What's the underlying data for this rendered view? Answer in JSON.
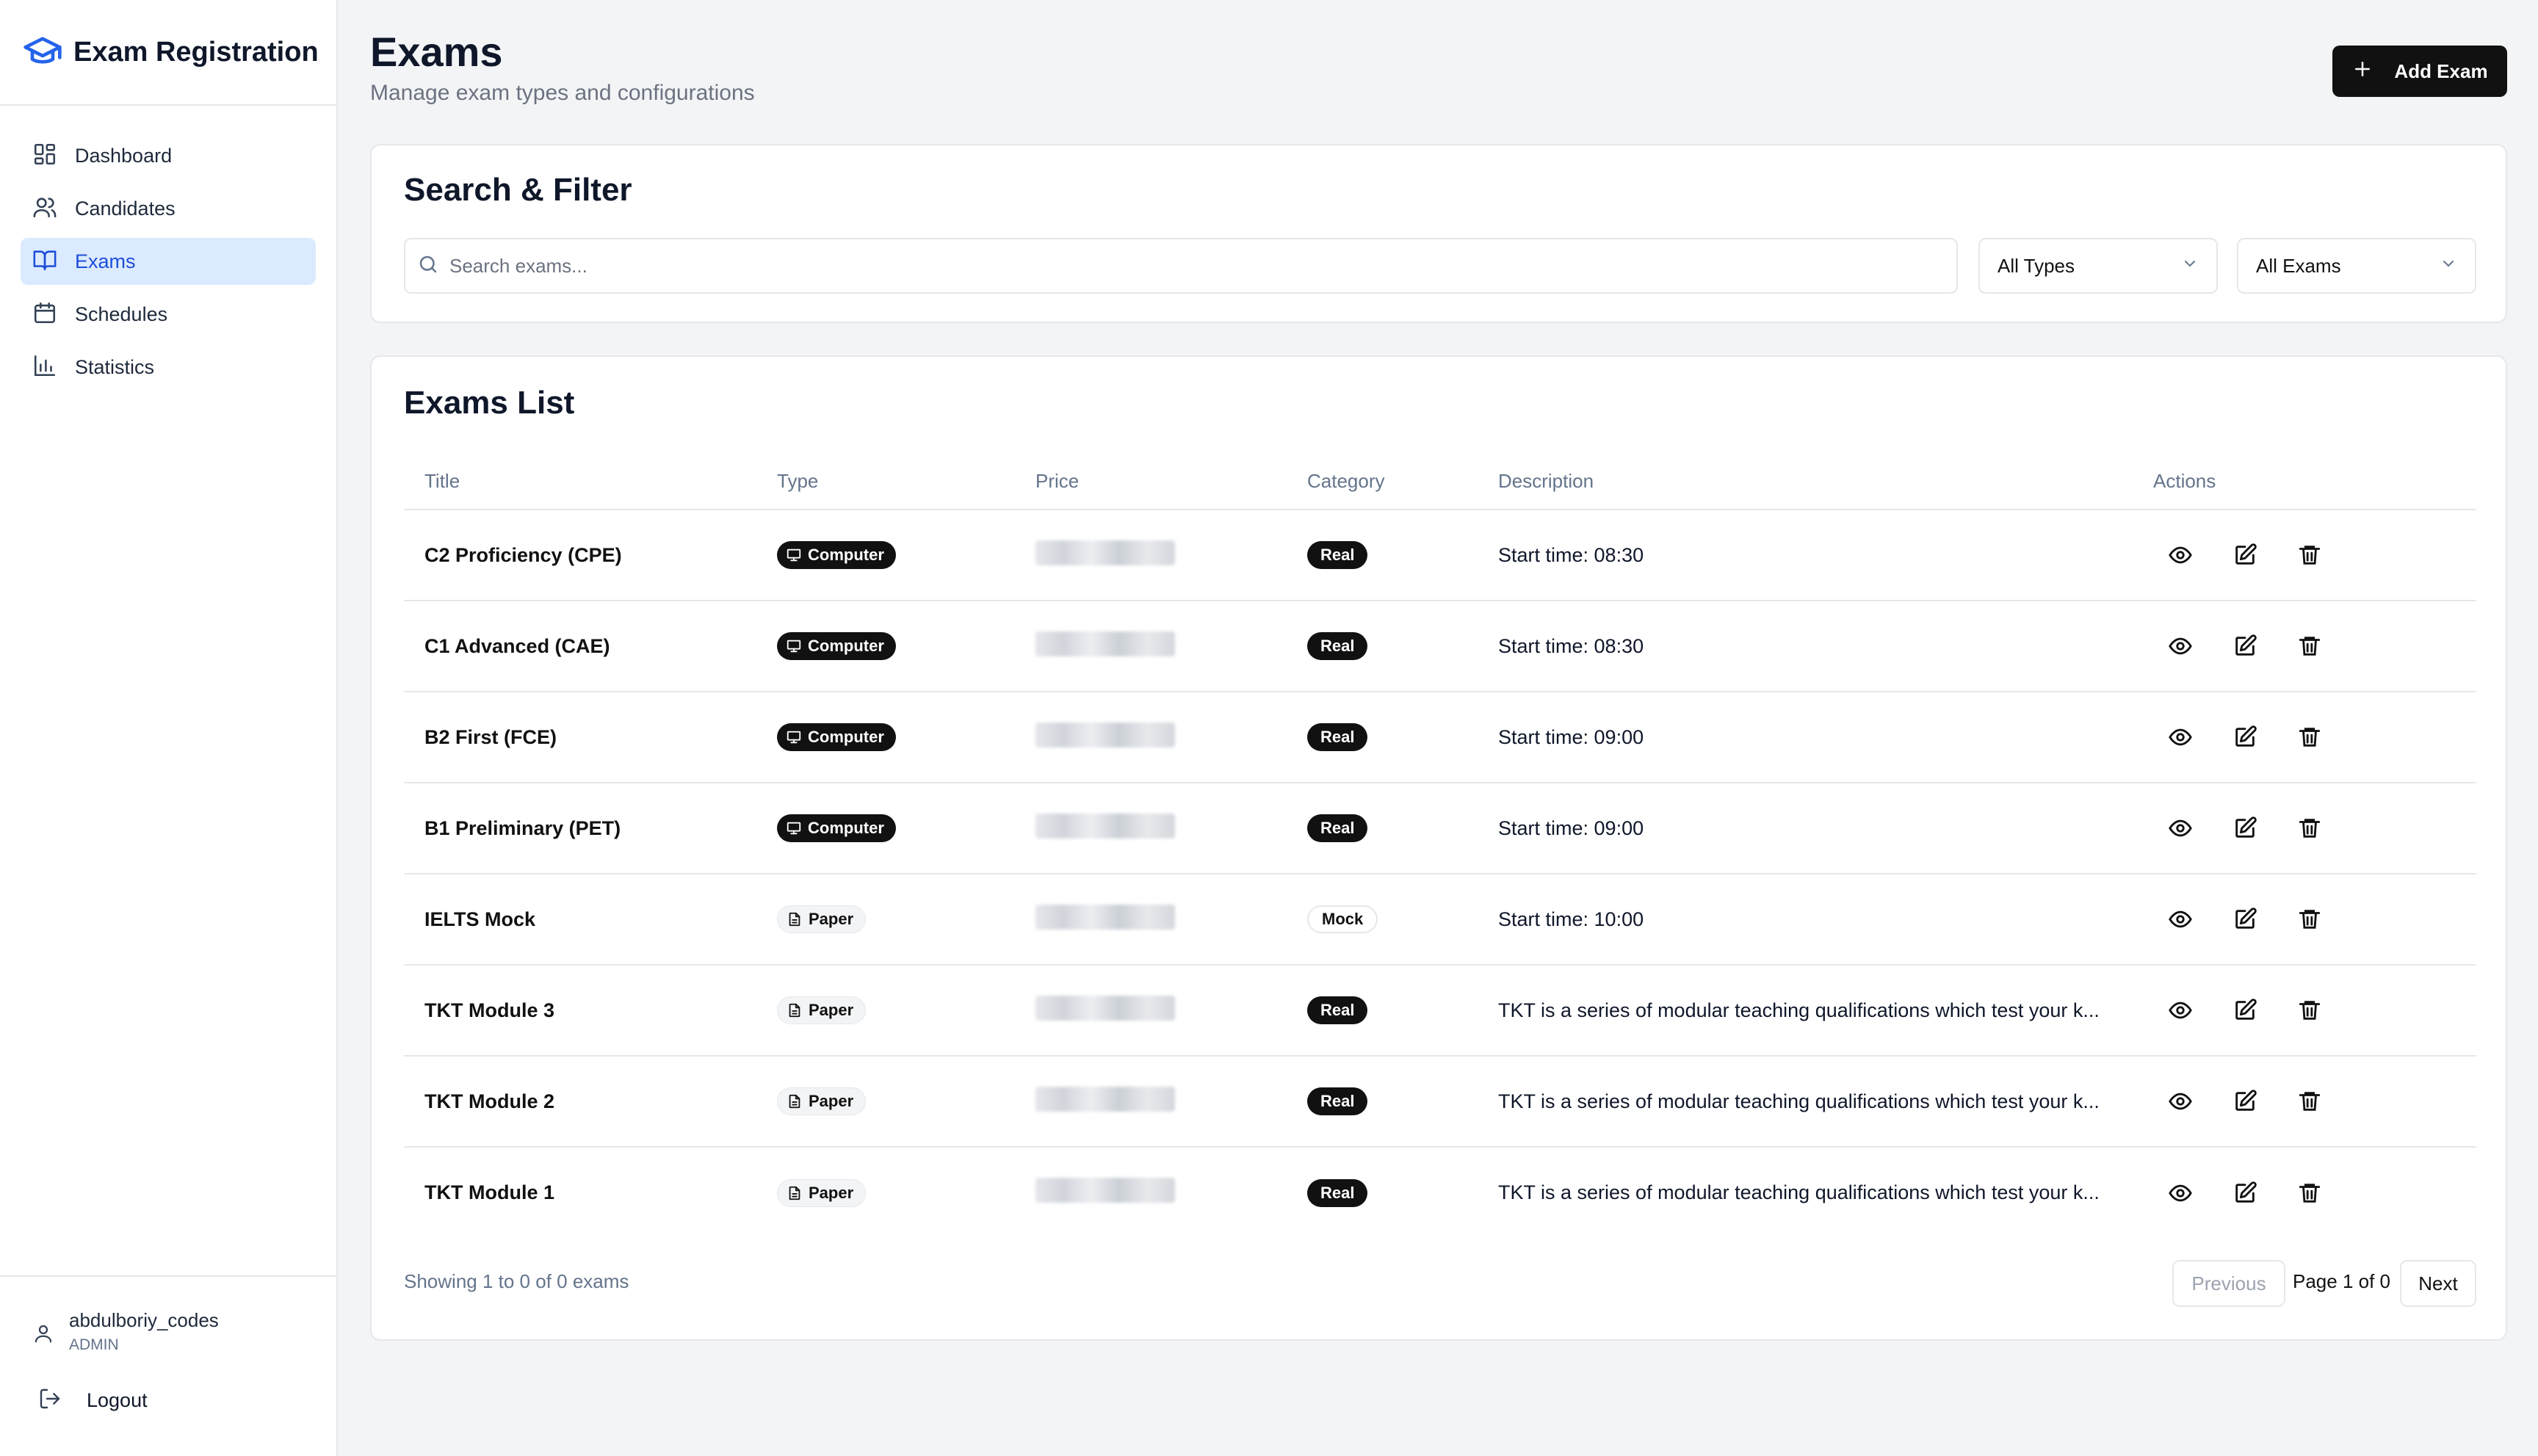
{
  "sidebar": {
    "brand": "Exam Registration",
    "nav": [
      {
        "label": "Dashboard",
        "icon": "dashboard-icon"
      },
      {
        "label": "Candidates",
        "icon": "users-icon"
      },
      {
        "label": "Exams",
        "icon": "book-icon",
        "active": true
      },
      {
        "label": "Schedules",
        "icon": "calendar-icon"
      },
      {
        "label": "Statistics",
        "icon": "bar-chart-icon"
      }
    ],
    "user": {
      "name": "abdulboriy_codes",
      "role": "ADMIN"
    },
    "logout_label": "Logout"
  },
  "header": {
    "title": "Exams",
    "subtitle": "Manage exam types and configurations",
    "add_button_label": "Add Exam"
  },
  "filter": {
    "title": "Search & Filter",
    "search_placeholder": "Search exams...",
    "type_select": "All Types",
    "exam_select": "All Exams"
  },
  "exams_list": {
    "title": "Exams List",
    "columns": [
      "Title",
      "Type",
      "Price",
      "Category",
      "Description",
      "Actions"
    ],
    "rows": [
      {
        "title": "C2 Proficiency (CPE)",
        "type": "Computer",
        "category": "Real",
        "description": "Start time: 08:30"
      },
      {
        "title": "C1 Advanced (CAE)",
        "type": "Computer",
        "category": "Real",
        "description": "Start time: 08:30"
      },
      {
        "title": "B2 First (FCE)",
        "type": "Computer",
        "category": "Real",
        "description": "Start time: 09:00"
      },
      {
        "title": "B1 Preliminary (PET)",
        "type": "Computer",
        "category": "Real",
        "description": "Start time: 09:00"
      },
      {
        "title": "IELTS Mock",
        "type": "Paper",
        "category": "Mock",
        "description": "Start time: 10:00"
      },
      {
        "title": "TKT Module 3",
        "type": "Paper",
        "category": "Real",
        "description": "TKT is a series of modular teaching qualifications which test your k..."
      },
      {
        "title": "TKT Module 2",
        "type": "Paper",
        "category": "Real",
        "description": "TKT is a series of modular teaching qualifications which test your k..."
      },
      {
        "title": "TKT Module 1",
        "type": "Paper",
        "category": "Real",
        "description": "TKT is a series of modular teaching qualifications which test your k..."
      }
    ],
    "showing_text": "Showing 1 to 0 of 0 exams",
    "prev_label": "Previous",
    "page_text": "Page 1 of 0",
    "next_label": "Next"
  },
  "colors": {
    "accent": "#2563eb",
    "active_bg": "#dbeafe",
    "primary_button": "#111111"
  }
}
